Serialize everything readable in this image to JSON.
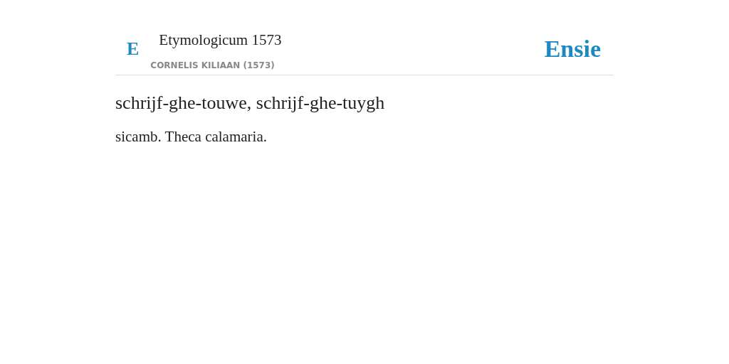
{
  "header": {
    "logo_letter": "E",
    "title": "Etymologicum 1573",
    "subtitle": "CORNELIS KILIAAN (1573)",
    "brand": "Ensie"
  },
  "entry": {
    "headword": "schrijf-ghe-touwe, schrijf-ghe-tuygh",
    "definition": "sicamb. Theca calamaria."
  }
}
